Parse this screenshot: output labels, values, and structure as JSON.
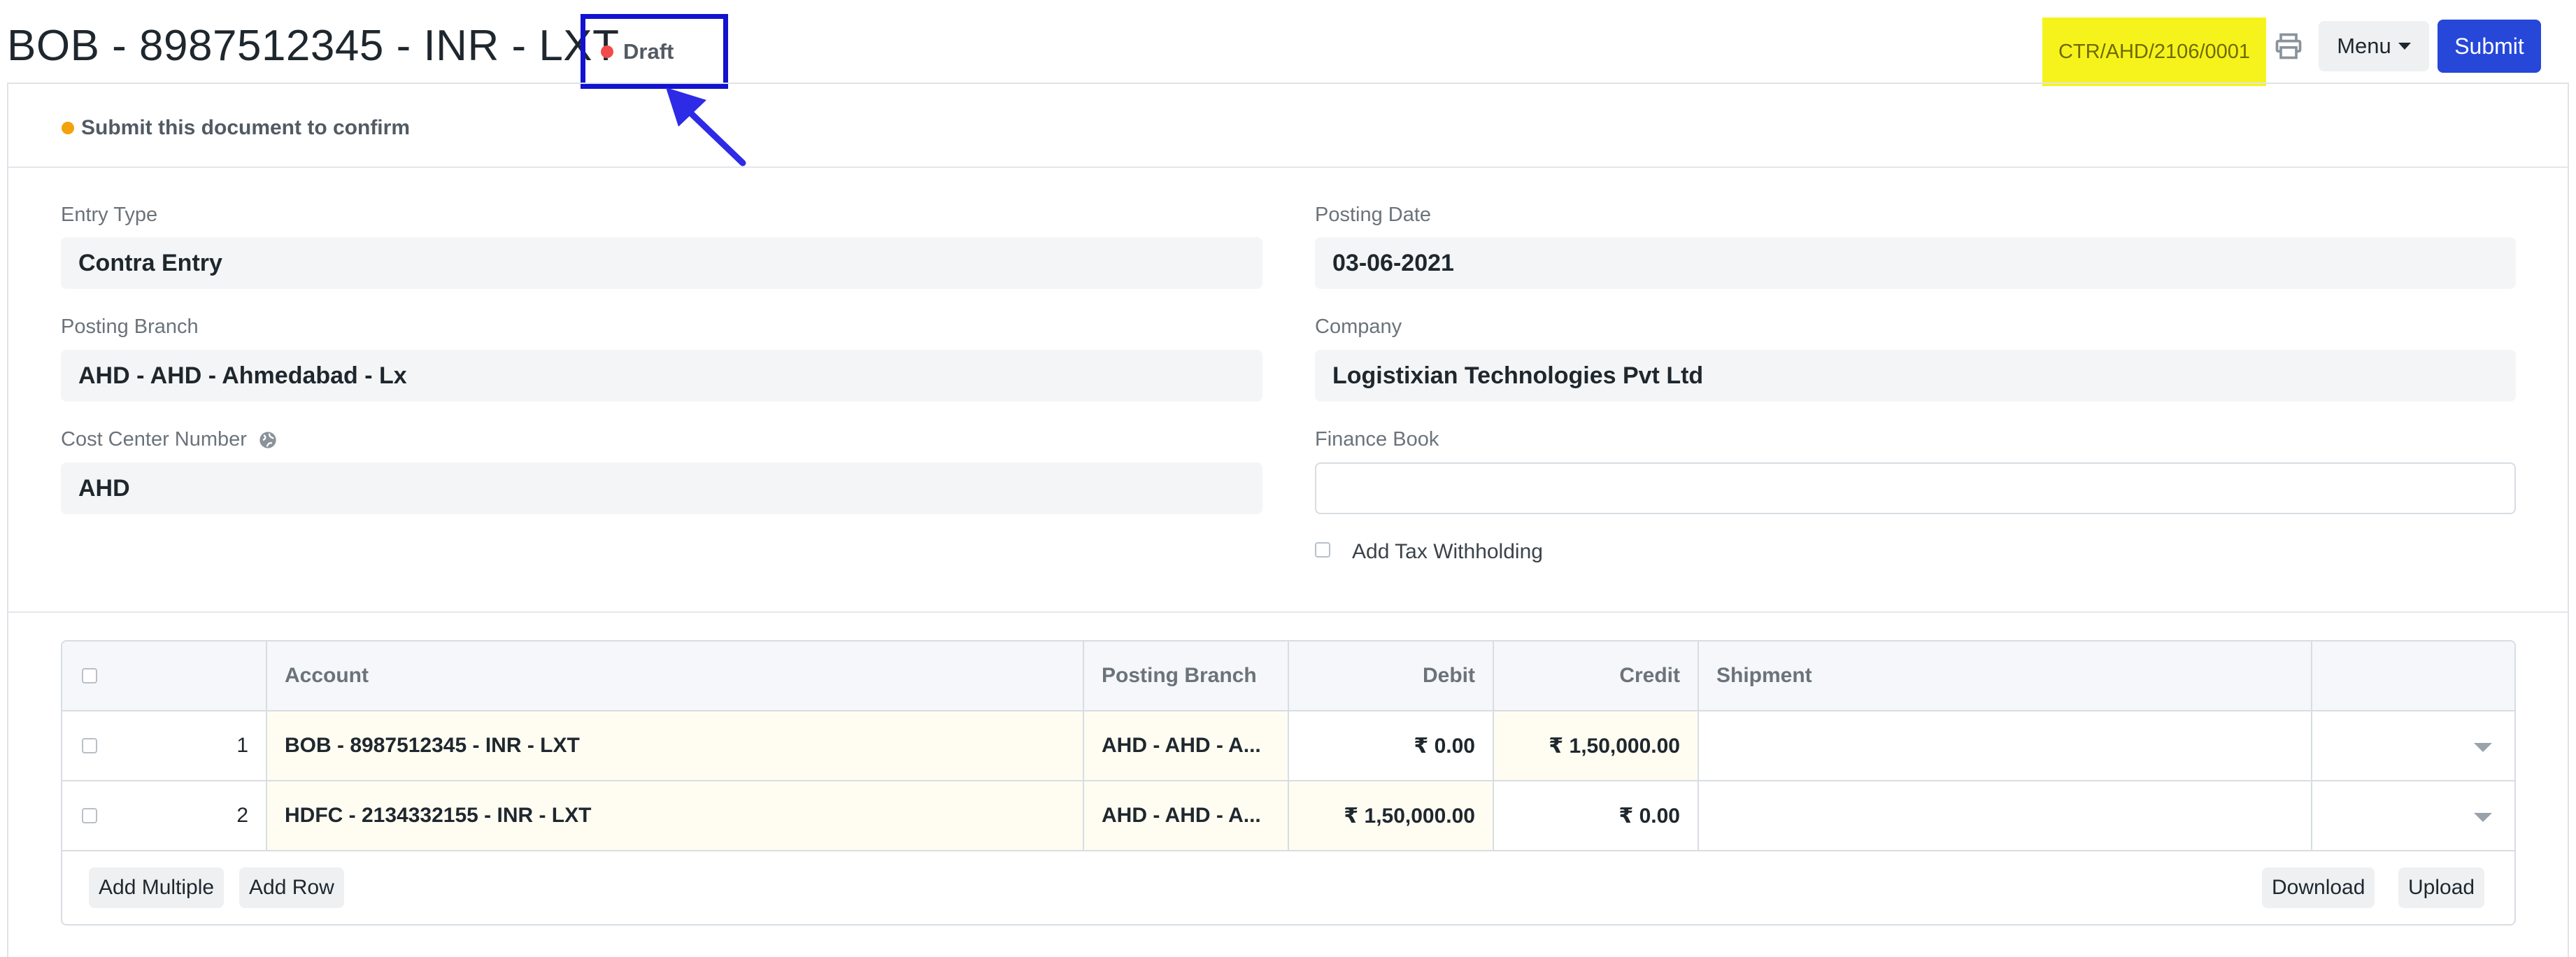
{
  "header": {
    "title": "BOB - 8987512345 - INR - LXT",
    "status": "Draft",
    "doc_id": "CTR/AHD/2106/0001",
    "menu_label": "Menu",
    "submit_label": "Submit"
  },
  "notice": "Submit this document to confirm",
  "form": {
    "entry_type": {
      "label": "Entry Type",
      "value": "Contra Entry"
    },
    "posting_date": {
      "label": "Posting Date",
      "value": "03-06-2021"
    },
    "posting_branch": {
      "label": "Posting Branch",
      "value": "AHD - AHD - Ahmedabad - Lx"
    },
    "company": {
      "label": "Company",
      "value": "Logistixian Technologies Pvt Ltd"
    },
    "cost_center": {
      "label": "Cost Center Number",
      "value": "AHD"
    },
    "finance_book": {
      "label": "Finance Book",
      "value": ""
    },
    "tax_withholding_label": "Add Tax Withholding"
  },
  "table": {
    "headers": {
      "account": "Account",
      "branch": "Posting Branch",
      "debit": "Debit",
      "credit": "Credit",
      "shipment": "Shipment"
    },
    "rows": [
      {
        "idx": "1",
        "account": "BOB - 8987512345 - INR - LXT",
        "branch": "AHD - AHD - A...",
        "debit": "₹ 0.00",
        "credit": "₹ 1,50,000.00",
        "shipment": ""
      },
      {
        "idx": "2",
        "account": "HDFC - 2134332155 - INR - LXT",
        "branch": "AHD - AHD - A...",
        "debit": "₹ 1,50,000.00",
        "credit": "₹ 0.00",
        "shipment": ""
      }
    ],
    "buttons": {
      "add_multiple": "Add Multiple",
      "add_row": "Add Row",
      "download": "Download",
      "upload": "Upload"
    }
  },
  "colors": {
    "primary": "#2647d8",
    "draft_dot": "#f24b4b",
    "notice_dot": "#f2a20a",
    "doc_id_highlight": "#f6f31c",
    "annotation": "#1212d0"
  },
  "icons": [
    "printer-icon",
    "chevron-down-icon",
    "globe-icon",
    "arrow-annotation-icon"
  ]
}
